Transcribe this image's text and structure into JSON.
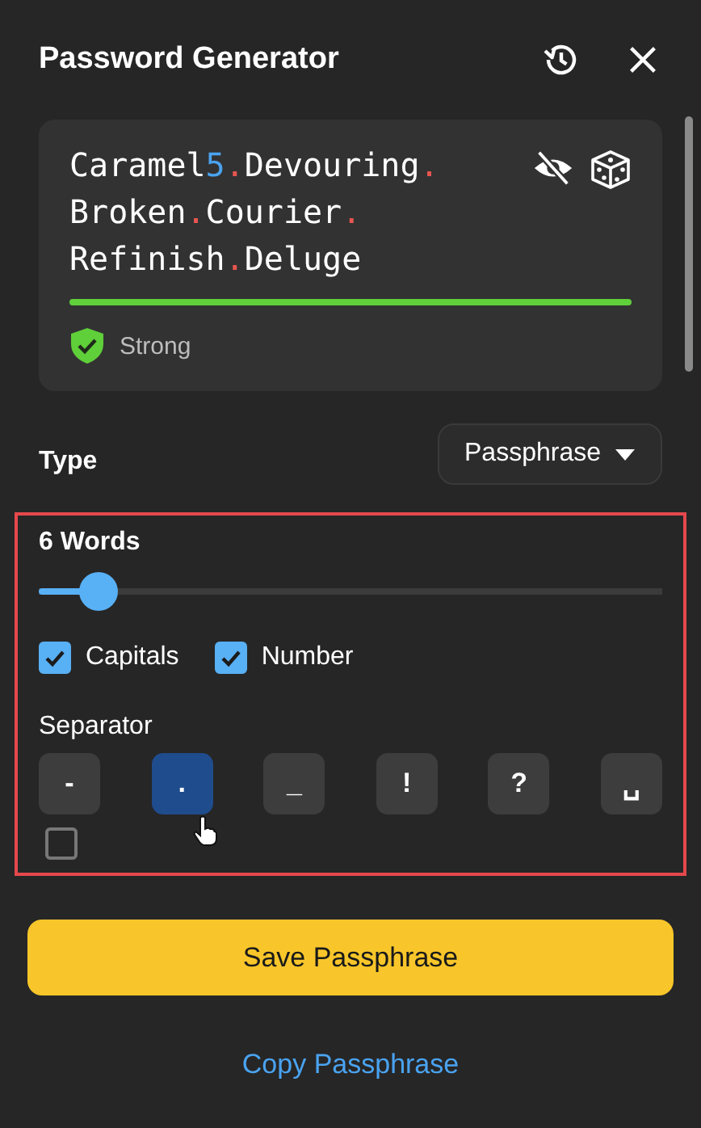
{
  "header": {
    "title": "Password Generator"
  },
  "password": {
    "segments": [
      {
        "kind": "word",
        "text": "Caramel"
      },
      {
        "kind": "number",
        "text": "5"
      },
      {
        "kind": "separator",
        "text": "."
      },
      {
        "kind": "word",
        "text": "Devouring"
      },
      {
        "kind": "separator",
        "text": "."
      },
      {
        "kind": "word",
        "text": "Broken"
      },
      {
        "kind": "separator",
        "text": "."
      },
      {
        "kind": "word",
        "text": "Courier"
      },
      {
        "kind": "separator",
        "text": "."
      },
      {
        "kind": "word",
        "text": "Refinish"
      },
      {
        "kind": "separator",
        "text": "."
      },
      {
        "kind": "word",
        "text": "Deluge"
      }
    ],
    "strength_meter": {
      "level": 1
    },
    "strength": "Strong"
  },
  "type": {
    "label": "Type",
    "value": "Passphrase"
  },
  "words": {
    "label": "6 Words",
    "level": 0.095
  },
  "options": [
    {
      "label": "Capitals",
      "checked": true
    },
    {
      "label": "Number",
      "checked": true
    }
  ],
  "separator": {
    "label": "Separator",
    "choices": [
      {
        "text": "-",
        "selected": false
      },
      {
        "text": ".",
        "selected": true
      },
      {
        "text": "_",
        "selected": false
      },
      {
        "text": "!",
        "selected": false
      },
      {
        "text": "?",
        "selected": false
      },
      {
        "text": "␣",
        "selected": false
      }
    ]
  },
  "clipped_option": {
    "checked": false
  },
  "save_button": "Save Passphrase",
  "copy_link": "Copy Passphrase"
}
